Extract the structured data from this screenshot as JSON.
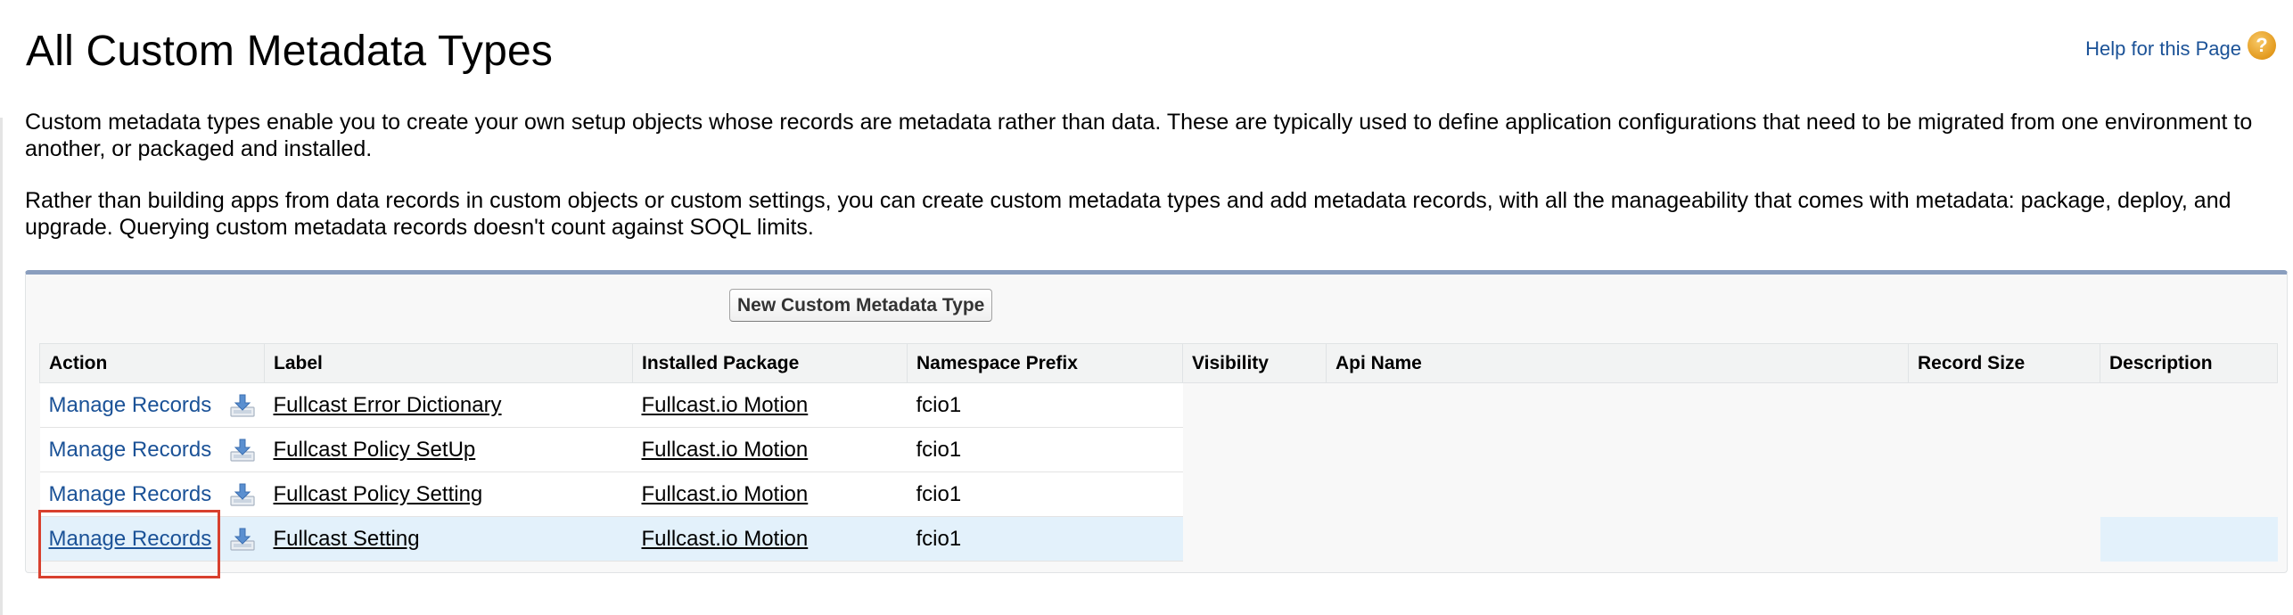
{
  "page": {
    "title": "All Custom Metadata Types",
    "help_link": "Help for this Page",
    "help_icon": "question-mark-icon",
    "intro_1": "Custom metadata types enable you to create your own setup objects whose records are metadata rather than data. These are typically used to define application configurations that need to be migrated from one environment to another, or packaged and installed.",
    "intro_2": "Rather than building apps from data records in custom objects or custom settings, you can create custom metadata types and add metadata records, with all the manageability that comes with metadata: package, deploy, and upgrade. Querying custom metadata records doesn't count against SOQL limits."
  },
  "toolbar": {
    "new_button_label": "New Custom Metadata Type"
  },
  "table": {
    "columns": [
      "Action",
      "Label",
      "Installed Package",
      "Namespace Prefix",
      "Visibility",
      "Api Name",
      "Record Size",
      "Description"
    ],
    "rows": [
      {
        "action": "Manage Records",
        "icon": "download-icon",
        "label": "Fullcast Error Dictionary",
        "package": "Fullcast.io Motion",
        "prefix": "fcio1"
      },
      {
        "action": "Manage Records",
        "icon": "download-icon",
        "label": "Fullcast Policy SetUp",
        "package": "Fullcast.io Motion",
        "prefix": "fcio1"
      },
      {
        "action": "Manage Records",
        "icon": "download-icon",
        "label": "Fullcast Policy Setting",
        "package": "Fullcast.io Motion",
        "prefix": "fcio1"
      },
      {
        "action": "Manage Records",
        "icon": "download-icon",
        "label": "Fullcast Setting",
        "package": "Fullcast.io Motion",
        "prefix": "fcio1"
      }
    ]
  },
  "colors": {
    "link": "#1b5297",
    "header_bar": "#8a9ebe",
    "highlight_row": "#e3f1fb",
    "callout": "#d8402e"
  }
}
